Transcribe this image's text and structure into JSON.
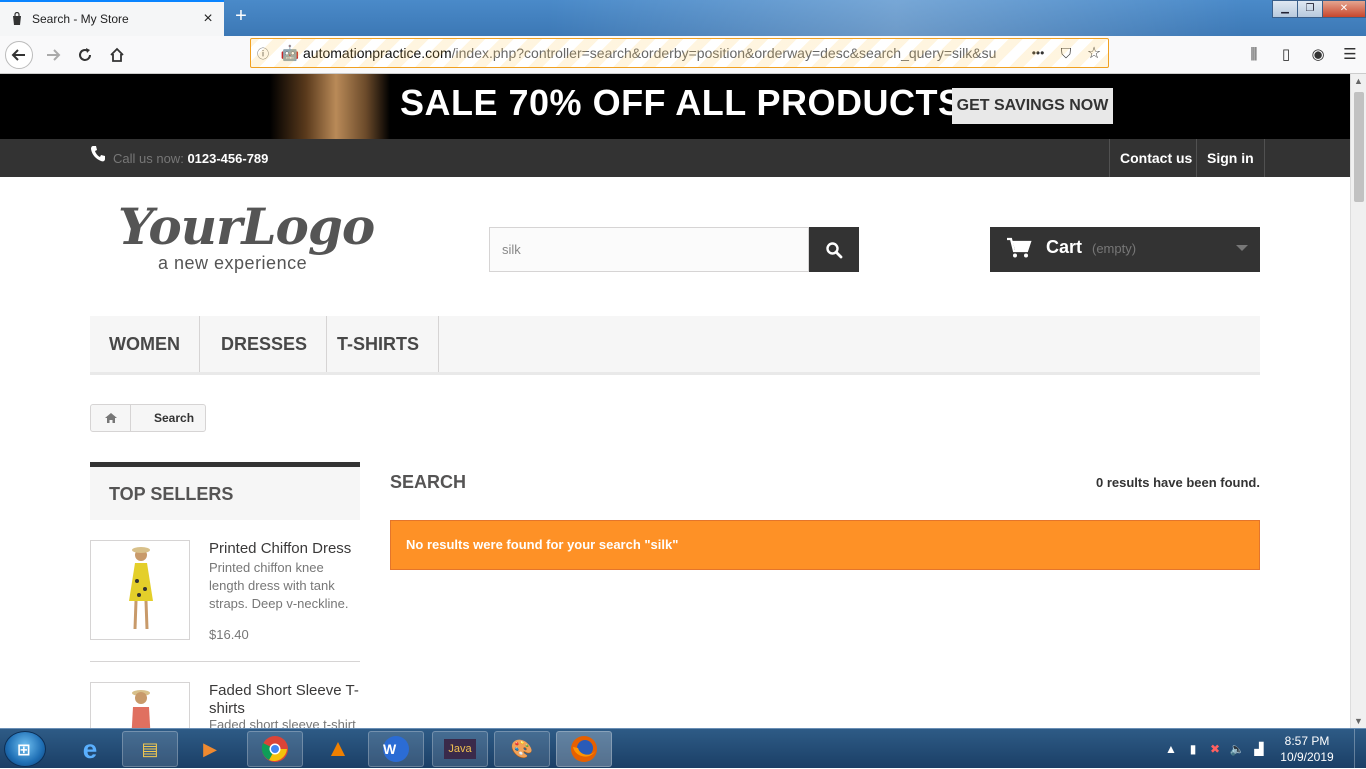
{
  "browser": {
    "tab_title": "Search - My Store",
    "new_tab": "+",
    "url_domain": "automationpractice.com",
    "url_path": "/index.php?controller=search&orderby=position&orderway=desc&search_query=silk&su",
    "url_more": "•••"
  },
  "banner": {
    "headline": "SALE 70% OFF ALL PRODUCTS",
    "cta": "GET SAVINGS NOW"
  },
  "header_nav": {
    "call_label": "Call us now:",
    "phone": "0123-456-789",
    "contact": "Contact us",
    "signin": "Sign in"
  },
  "logo": {
    "script": "YourLogo",
    "tagline": "a new experience"
  },
  "search": {
    "query": "silk"
  },
  "cart": {
    "label": "Cart",
    "status": "(empty)"
  },
  "menu": {
    "items": [
      "WOMEN",
      "DRESSES",
      "T-SHIRTS"
    ]
  },
  "breadcrumb": {
    "current": "Search"
  },
  "sidebar": {
    "title": "TOP SELLERS",
    "products": [
      {
        "name": "Printed Chiffon Dress",
        "desc": "Printed chiffon knee length dress with tank straps. Deep v-neckline.",
        "price": "$16.40"
      },
      {
        "name": "Faded Short Sleeve T-shirts",
        "desc": "Faded short sleeve t-shirt"
      }
    ]
  },
  "results": {
    "heading": "SEARCH",
    "count": "0 results have been found.",
    "alert": "No results were found for your search \"silk\""
  },
  "taskbar": {
    "time": "8:57 PM",
    "date": "10/9/2019"
  },
  "colors": {
    "alert_orange": "#fe9126",
    "header_dark": "#333333",
    "banner_black": "#000000"
  }
}
